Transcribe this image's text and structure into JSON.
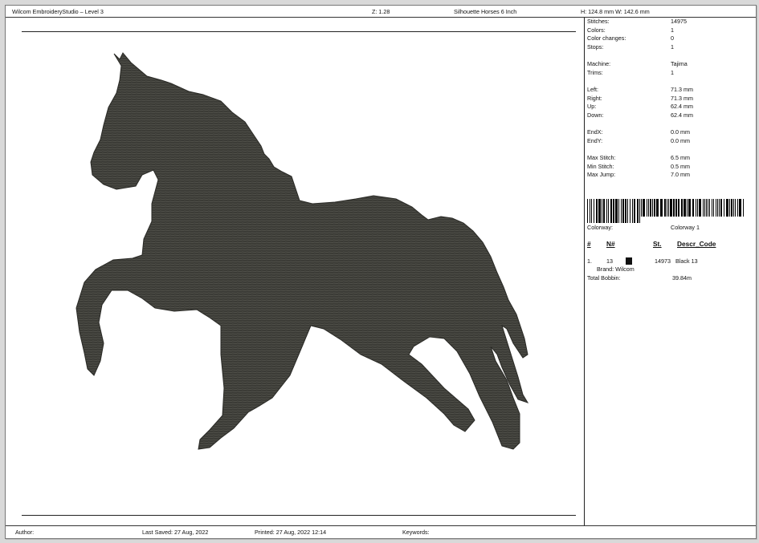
{
  "header": {
    "app_title": "Wilcom EmbroideryStudio – Level 3",
    "zoom": "Z: 1.28",
    "design_name": "Silhouette Horses 6 Inch",
    "dimensions": "H: 124.8 mm   W: 142.6 mm"
  },
  "stats": [
    {
      "label": "Stitches:",
      "value": "14975"
    },
    {
      "label": "Colors:",
      "value": "1"
    },
    {
      "label": "Color changes:",
      "value": "0"
    },
    {
      "label": "Stops:",
      "value": "1"
    },
    {
      "label": "Machine:",
      "value": "Tajima"
    },
    {
      "label": "Trims:",
      "value": "1"
    },
    {
      "label": "Left:",
      "value": "71.3 mm"
    },
    {
      "label": "Right:",
      "value": "71.3 mm"
    },
    {
      "label": "Up:",
      "value": "62.4 mm"
    },
    {
      "label": "Down:",
      "value": "62.4 mm"
    },
    {
      "label": "EndX:",
      "value": "0.0 mm"
    },
    {
      "label": "EndY:",
      "value": "0.0 mm"
    },
    {
      "label": "Max Stitch:",
      "value": "6.5 mm"
    },
    {
      "label": "Min Stitch:",
      "value": "0.5 mm"
    },
    {
      "label": "Max Jump:",
      "value": "7.0 mm"
    }
  ],
  "colorway": {
    "label": "Colorway:",
    "value": "Colorway 1"
  },
  "color_table": {
    "headers": [
      "#",
      "N#",
      "St.",
      "Descr_Code"
    ],
    "rows": [
      {
        "index": "1.",
        "needle": "13",
        "stitches": "14973",
        "descr": "Black 13",
        "brand": "Brand: Wilcom",
        "swatch": "#111111"
      }
    ]
  },
  "total_bobbin": {
    "label": "Total Bobbin:",
    "value": "39.84m"
  },
  "footer": {
    "author": "Author:",
    "last_saved": "Last Saved: 27 Aug, 2022",
    "printed": "Printed: 27 Aug, 2022 12:14",
    "keywords": "Keywords:"
  },
  "design": {
    "fill_color": "#3b3b36",
    "icon": "horse-silhouette"
  }
}
